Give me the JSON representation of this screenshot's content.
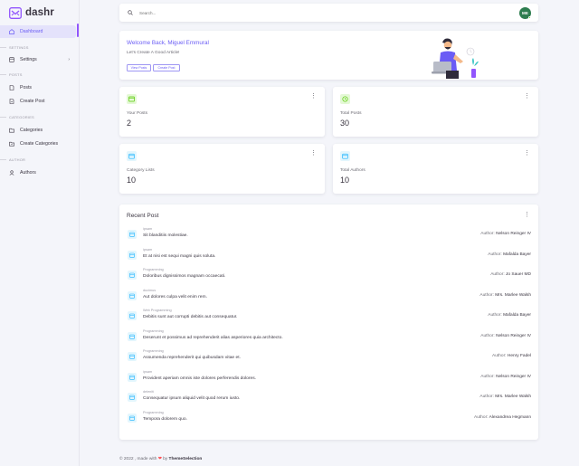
{
  "app": {
    "name": "dashr"
  },
  "sidebar": {
    "dashboard": "Dashboard",
    "sections": [
      {
        "label": "SETTINGS",
        "items": [
          "Settings"
        ]
      },
      {
        "label": "POSTS",
        "items": [
          "Posts",
          "Create Post"
        ]
      },
      {
        "label": "CATEGORIES",
        "items": [
          "Categories",
          "Create Categories"
        ]
      },
      {
        "label": "AUTHOR",
        "items": [
          "Authors"
        ]
      }
    ]
  },
  "search": {
    "placeholder": "Search..."
  },
  "user": {
    "initials": "ME"
  },
  "welcome": {
    "title": "Welcome Back, Miguel Emmural",
    "subtitle": "Let's Create A Good Article!",
    "view_posts": "View Posts",
    "create_post": "Create Post"
  },
  "stats": [
    {
      "label": "Your Posts",
      "value": "2",
      "icon": "image-icon",
      "color": "#56ca00"
    },
    {
      "label": "Total Posts",
      "value": "30",
      "icon": "clock-icon",
      "color": "#56ca00"
    },
    {
      "label": "Category Lists",
      "value": "10",
      "icon": "calendar-icon",
      "color": "#16b1ff"
    },
    {
      "label": "Total Authors",
      "value": "10",
      "icon": "calendar-icon",
      "color": "#16b1ff"
    }
  ],
  "recent": {
    "title": "Recent Post",
    "author_prefix": "Author:",
    "rows": [
      {
        "category": "ipsam",
        "title": "Sit blanditiis molestiae.",
        "author": "Nelson Reinger IV"
      },
      {
        "category": "ipsam",
        "title": "Et at nisi est sequi magni quis soluta.",
        "author": "Mafalda Bayer"
      },
      {
        "category": "Programming",
        "title": "Doloribus dignissimos magnam occaecati.",
        "author": "Jo Sauer MD"
      },
      {
        "category": "ducimus",
        "title": "Aut dolores culpa velit enim rem.",
        "author": "Mrs. Marlee Walsh"
      },
      {
        "category": "Web Programming",
        "title": "Debitis sunt aut corrupti debitis aut consequatur.",
        "author": "Mafalda Bayer"
      },
      {
        "category": "Programming",
        "title": "Deserunt et possimus ad reprehenderit alias asperiores quia architecto.",
        "author": "Nelson Reinger IV"
      },
      {
        "category": "Programming",
        "title": "Assumenda reprehenderit qui quibusdam vitae et.",
        "author": "Henry Fadel"
      },
      {
        "category": "ipsam",
        "title": "Provident aperiam omnis iste dolores perferendis dolores.",
        "author": "Nelson Reinger IV"
      },
      {
        "category": "deleniti",
        "title": "Consequatur ipsum aliquid velit quod rerum iusto.",
        "author": "Mrs. Marlee Walsh"
      },
      {
        "category": "Programming",
        "title": "Tempora dolorem quo.",
        "author": "Alexandrea Hegmann"
      }
    ]
  },
  "footer": {
    "prefix": "© 2022 , made with",
    "by": "by",
    "brand": "ThemeSelection"
  },
  "colors": {
    "accent": "#9155fd",
    "success": "#56ca00",
    "info": "#16b1ff"
  }
}
